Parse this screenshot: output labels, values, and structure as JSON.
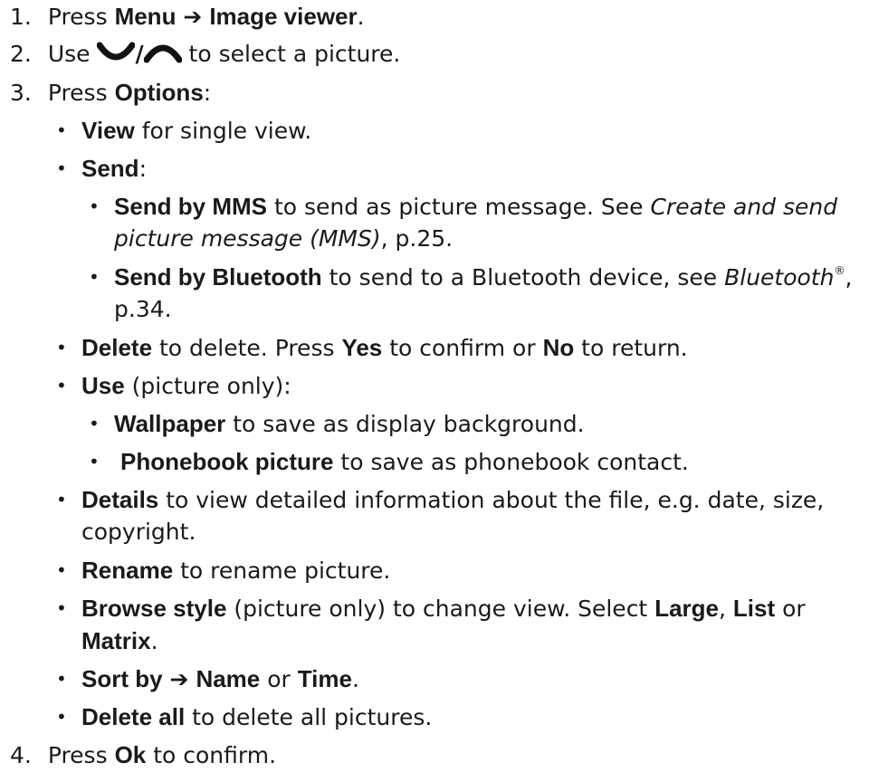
{
  "steps": [
    {
      "num": "1.",
      "pre": "Press ",
      "b1": "Menu",
      "arrow": "➔",
      "b2": "Image viewer",
      "post": "."
    },
    {
      "num": "2.",
      "pre": "Use ",
      "slash": "/",
      "post": " to select a picture.",
      "icons": [
        "nav-down-icon",
        "nav-up-icon"
      ]
    },
    {
      "num": "3.",
      "pre": "Press ",
      "b1": "Options",
      "post": ":"
    },
    {
      "num": "4.",
      "pre": "Press ",
      "b1": "Ok",
      "post": " to confirm."
    }
  ],
  "options": {
    "view": {
      "label": "View",
      "text": " for single view."
    },
    "send": {
      "label": "Send",
      "text": ":"
    },
    "send_mms": {
      "label": "Send by MMS",
      "text": " to send as picture message. See ",
      "ref": "Create and send",
      "ref2": "picture message (MMS)",
      "page": ", p.25."
    },
    "send_bt": {
      "label": "Send by Bluetooth",
      "text": " to send to a Bluetooth device, see ",
      "ref": "Bluetooth",
      "reg": "®",
      "comma": ",",
      "page": "p.34."
    },
    "delete": {
      "label": "Delete",
      "text1": " to delete. Press ",
      "yes": "Yes",
      "text2": " to confirm or ",
      "no": "No",
      "text3": " to return."
    },
    "use": {
      "label": "Use",
      "text": " (picture only):"
    },
    "wallpaper": {
      "label": "Wallpaper",
      "text": " to save as display background."
    },
    "phonebook": {
      "label": "Phonebook picture",
      "text": " to save as phonebook contact."
    },
    "details": {
      "label": "Details",
      "text": " to view detailed information about the file, e.g. date, size,",
      "text2": "copyright."
    },
    "rename": {
      "label": "Rename",
      "text": " to rename picture."
    },
    "browse": {
      "label": "Browse style",
      "text": " (picture only) to change view. Select ",
      "large": "Large",
      "comma": ", ",
      "list": "List",
      "or": " or",
      "matrix": "Matrix",
      "end": "."
    },
    "sort": {
      "label": "Sort by",
      "arrow": "➔",
      "name": "Name",
      "or": " or ",
      "time": "Time",
      "end": "."
    },
    "delete_all": {
      "label": "Delete all",
      "text": " to delete all pictures."
    }
  },
  "bullet": "•"
}
